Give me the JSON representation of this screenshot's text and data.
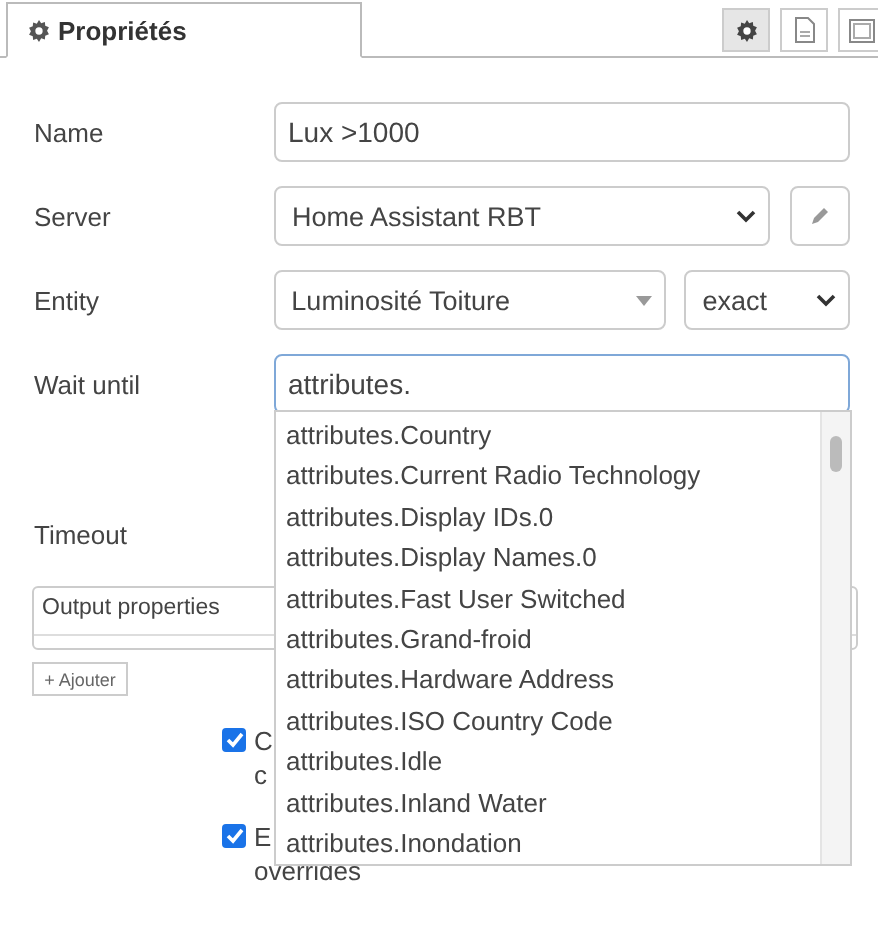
{
  "tab": {
    "label": "Propriétés",
    "selected": true
  },
  "header_icons": [
    {
      "kind": "gear",
      "selected": true
    },
    {
      "kind": "document",
      "selected": false
    },
    {
      "kind": "frame",
      "selected": false
    }
  ],
  "fields": [
    {
      "kind": "input",
      "label": "Name",
      "value": "Lux >1000"
    },
    {
      "kind": "select",
      "label": "Server",
      "value": "Home Assistant RBT"
    },
    {
      "kind": "entity",
      "label": "Entity",
      "value": "Luminosité Toiture",
      "match": "exact"
    },
    {
      "kind": "focused",
      "label": "Wait until",
      "value": "attributes."
    }
  ],
  "suggestions": [
    "attributes.Country",
    "attributes.Current Radio Technology",
    "attributes.Display IDs.0",
    "attributes.Display Names.0",
    "attributes.Fast User Switched",
    "attributes.Grand-froid",
    "attributes.Hardware Address",
    "attributes.ISO Country Code",
    "attributes.Idle",
    "attributes.Inland Water",
    "attributes.Inondation"
  ],
  "timeout_label": "Timeout",
  "output_properties": {
    "title": "Output properties"
  },
  "add_button": "+ Ajouter",
  "checkboxes": [
    {
      "checked": true,
      "lines": [
        "C",
        "c"
      ]
    },
    {
      "checked": true,
      "lines": [
        "E",
        "overrides"
      ]
    }
  ]
}
